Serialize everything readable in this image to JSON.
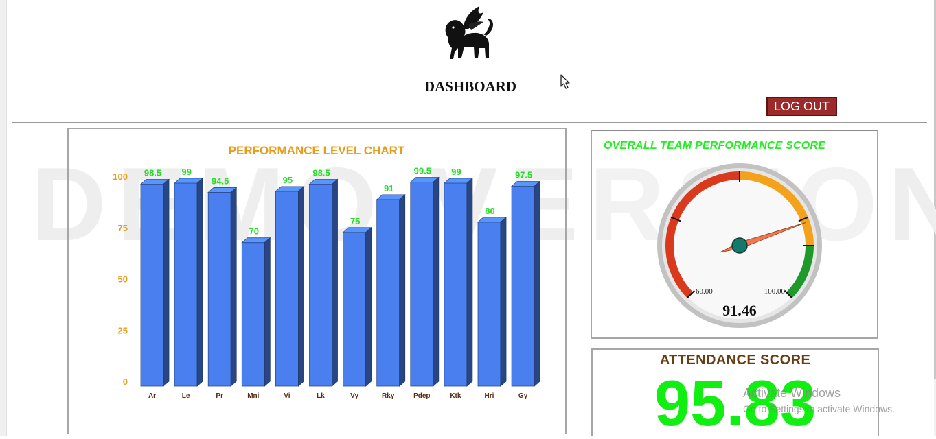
{
  "header": {
    "title": "DASHBOARD",
    "logout_label": "LOG OUT"
  },
  "watermark": "DEMO VERSION",
  "performance_chart": {
    "title": "PERFORMANCE LEVEL CHART"
  },
  "gauge": {
    "title": "OVERALL TEAM PERFORMANCE SCORE",
    "value": 91.46,
    "value_text": "91.46",
    "min_label": "60.00",
    "max_label": "100.00",
    "bands": [
      {
        "from": 0,
        "to": 60,
        "color": "#d93a1e"
      },
      {
        "from": 60,
        "to": 100,
        "color": "#f4a21b"
      },
      {
        "from": 100,
        "to": 120,
        "color": "#1e9a2a"
      }
    ],
    "needle_color": "#f07850",
    "hub_color": "#127a6a"
  },
  "attendance": {
    "title": "ATTENDANCE SCORE",
    "value": "95.83"
  },
  "os_overlay": {
    "line1": "Activate Windows",
    "line2": "Go to Settings to activate Windows."
  },
  "chart_data": {
    "type": "bar",
    "title": "PERFORMANCE LEVEL CHART",
    "categories": [
      "Ar",
      "Le",
      "Pr",
      "Mni",
      "Vi",
      "Lk",
      "Vy",
      "Rky",
      "Pdep",
      "Ktk",
      "Hri",
      "Gy"
    ],
    "values": [
      98.5,
      99,
      94.5,
      70,
      95,
      98.5,
      75,
      91,
      99.5,
      99,
      80,
      97.5
    ],
    "ylim": [
      0,
      100
    ],
    "yticks": [
      0,
      25,
      50,
      75,
      100
    ],
    "bar_color": "#4a7ff0",
    "label_color": "#22dd22",
    "tick_color": "#e89c18",
    "category_color": "#5a2a10",
    "title_color": "#e89c18",
    "grid": false
  }
}
